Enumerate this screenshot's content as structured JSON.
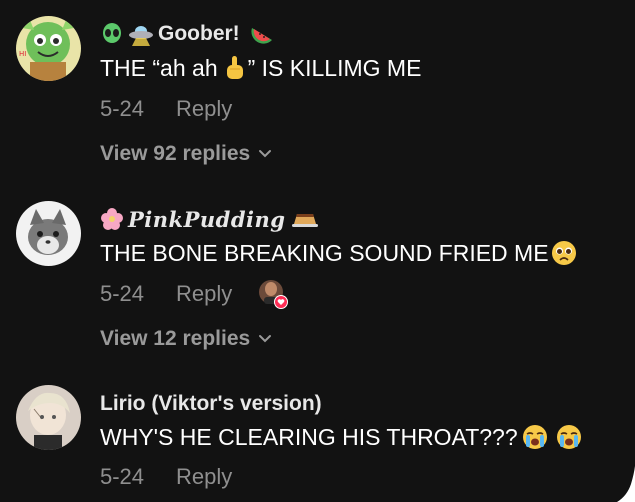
{
  "comments": [
    {
      "username": "Goober!",
      "text_before": "THE “ah ah",
      "text_after": " ” IS KILLIMG ME",
      "date": "5-24",
      "reply_label": "Reply",
      "view_replies": "View 92 replies",
      "icons": [
        "alien-icon",
        "ufo-icon",
        "watermelon-icon",
        "pointing-up-icon"
      ]
    },
    {
      "username": "PinkPudding",
      "text": "THE BONE BREAKING SOUND FRIED ME",
      "date": "5-24",
      "reply_label": "Reply",
      "view_replies": "View 12 replies",
      "icons": [
        "cherry-blossom-icon",
        "pudding-icon",
        "pleading-face-icon",
        "creator-liked-avatar"
      ]
    },
    {
      "username": "Lirio (Viktor's version)",
      "text": "WHY'S HE CLEARING HIS THROAT???",
      "date": "5-24",
      "reply_label": "Reply",
      "icons": [
        "crying-face-icon",
        "crying-face-icon"
      ]
    }
  ],
  "colors": {
    "background": "#121212",
    "secondary_text": "#8f8f8f",
    "like_badge": "#fe2c55"
  }
}
